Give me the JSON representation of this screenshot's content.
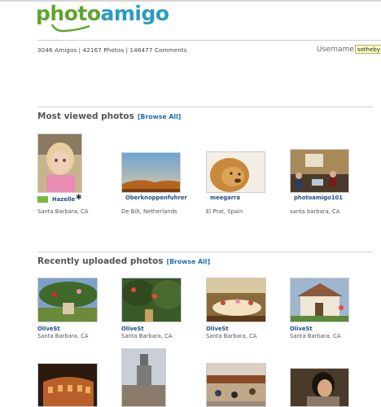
{
  "logo": {
    "part1": "photo",
    "part2": "amigo"
  },
  "stats": "3046 Amigos | 42167 Photos | 146477 Comments",
  "login": {
    "username_label": "Username",
    "username_value": "sotheby"
  },
  "most_viewed": {
    "title": "Most viewed photos",
    "browse": "[Browse All]",
    "items": [
      {
        "user": "Hazelle",
        "location": "Santa Barbara, CA"
      },
      {
        "user": "Oberknoppenfuhrer",
        "location": "De Bilt, Netherlands"
      },
      {
        "user": "meegarra",
        "location": "El Prat, Spain"
      },
      {
        "user": "photoamigo101",
        "location": "santa barbara, CA"
      }
    ]
  },
  "recent": {
    "title": "Recently uploaded photos",
    "browse": "[Browse All]",
    "items": [
      {
        "user": "OliveSt",
        "location": "Santa Barbara, CA"
      },
      {
        "user": "OliveSt",
        "location": "Santa Barbara, CA"
      },
      {
        "user": "OliveSt",
        "location": "Santa Barbara, CA"
      },
      {
        "user": "OliveSt",
        "location": "Santa Barbara, CA"
      }
    ]
  }
}
